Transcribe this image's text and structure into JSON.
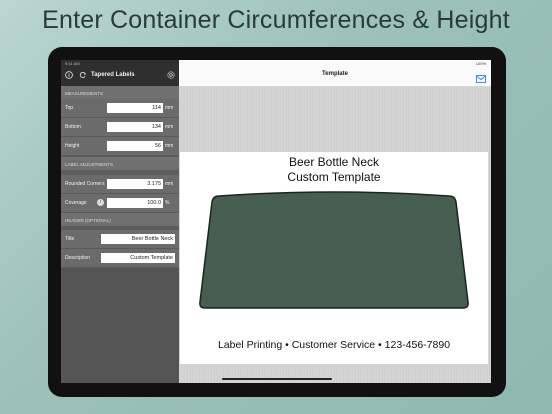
{
  "headline": "Enter Container Circumferences & Height",
  "status": {
    "time": "9:41 AM",
    "battery": "100%"
  },
  "sidebar": {
    "title": "Tapered Labels",
    "sections": {
      "measurements": "MEASUREMENTS",
      "label_adjustments": "LABEL ADJUSTMENTS",
      "header": "HEADER (OPTIONAL)"
    },
    "measurements": [
      {
        "label": "Top",
        "value": "114",
        "unit": "mm"
      },
      {
        "label": "Bottom",
        "value": "134",
        "unit": "mm"
      },
      {
        "label": "Height",
        "value": "56",
        "unit": "mm"
      }
    ],
    "adjustments": [
      {
        "label": "Rounded Corners",
        "value": "3.175",
        "unit": "mm"
      },
      {
        "label": "Coverage",
        "value": "100.0",
        "unit": "%"
      }
    ],
    "header": [
      {
        "label": "Title",
        "value": "Beer Bottle Neck"
      },
      {
        "label": "Description",
        "value": "Custom Template"
      }
    ]
  },
  "main": {
    "title": "Template",
    "card_title_line1": "Beer Bottle Neck",
    "card_title_line2": "Custom Template",
    "footer": "Label Printing • Customer Service • 123-456-7890"
  },
  "colors": {
    "label_fill": "#465e50",
    "label_stroke": "#1b2520",
    "accent": "#2e7cf6"
  },
  "icons": [
    "info-icon",
    "refresh-icon",
    "settings-gear-icon",
    "mail-icon"
  ]
}
